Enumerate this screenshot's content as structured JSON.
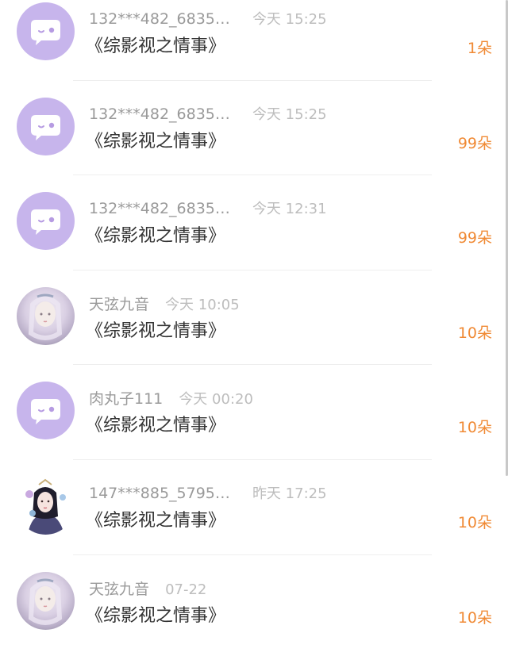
{
  "gifts": [
    {
      "user": "132***482_6835…",
      "time": "今天 15:25",
      "title": "《综影视之情事》",
      "amount": "1朵",
      "avatar": "default"
    },
    {
      "user": "132***482_6835…",
      "time": "今天 15:25",
      "title": "《综影视之情事》",
      "amount": "99朵",
      "avatar": "default"
    },
    {
      "user": "132***482_6835…",
      "time": "今天 12:31",
      "title": "《综影视之情事》",
      "amount": "99朵",
      "avatar": "default"
    },
    {
      "user": "天弦九音",
      "time": "今天 10:05",
      "title": "《综影视之情事》",
      "amount": "10朵",
      "avatar": "photo"
    },
    {
      "user": "肉丸子111",
      "time": "今天 00:20",
      "title": "《综影视之情事》",
      "amount": "10朵",
      "avatar": "default"
    },
    {
      "user": "147***885_5795…",
      "time": "昨天 17:25",
      "title": "《综影视之情事》",
      "amount": "10朵",
      "avatar": "photo2"
    },
    {
      "user": "天弦九音",
      "time": "07-22",
      "title": "《综影视之情事》",
      "amount": "10朵",
      "avatar": "photo"
    }
  ],
  "colors": {
    "accent": "#f08a35",
    "default_avatar": "#c7b5ec"
  }
}
